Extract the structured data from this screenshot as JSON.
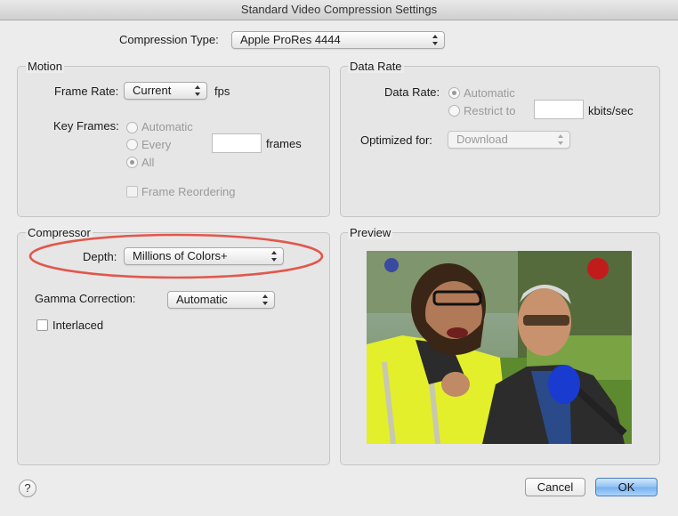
{
  "window": {
    "title": "Standard Video Compression Settings"
  },
  "compression_type": {
    "label": "Compression Type:",
    "value": "Apple ProRes 4444"
  },
  "motion": {
    "title": "Motion",
    "frame_rate_label": "Frame Rate:",
    "frame_rate_value": "Current",
    "fps_label": "fps",
    "key_frames_label": "Key Frames:",
    "key_frames_options": [
      "Automatic",
      "Every",
      "All"
    ],
    "key_frames_selected": "All",
    "frames_label": "frames",
    "frames_value": "",
    "frame_reordering_label": "Frame Reordering"
  },
  "data_rate": {
    "title": "Data Rate",
    "data_rate_label": "Data Rate:",
    "options": [
      "Automatic",
      "Restrict to"
    ],
    "selected": "Automatic",
    "kbits_label": "kbits/sec",
    "kbits_value": "",
    "optimized_label": "Optimized for:",
    "optimized_value": "Download"
  },
  "compressor": {
    "title": "Compressor",
    "depth_label": "Depth:",
    "depth_value": "Millions of Colors+",
    "gamma_label": "Gamma Correction:",
    "gamma_value": "Automatic",
    "interlaced_label": "Interlaced",
    "interlaced_checked": false,
    "highlight_color": "#e2574c"
  },
  "preview": {
    "title": "Preview",
    "image_description": "two men outdoors, one in yellow high-visibility vest, microphone"
  },
  "footer": {
    "help_label": "?",
    "cancel_label": "Cancel",
    "ok_label": "OK"
  },
  "colors": {
    "accent_button": "#7ab6f1",
    "window_bg": "#ececec"
  }
}
